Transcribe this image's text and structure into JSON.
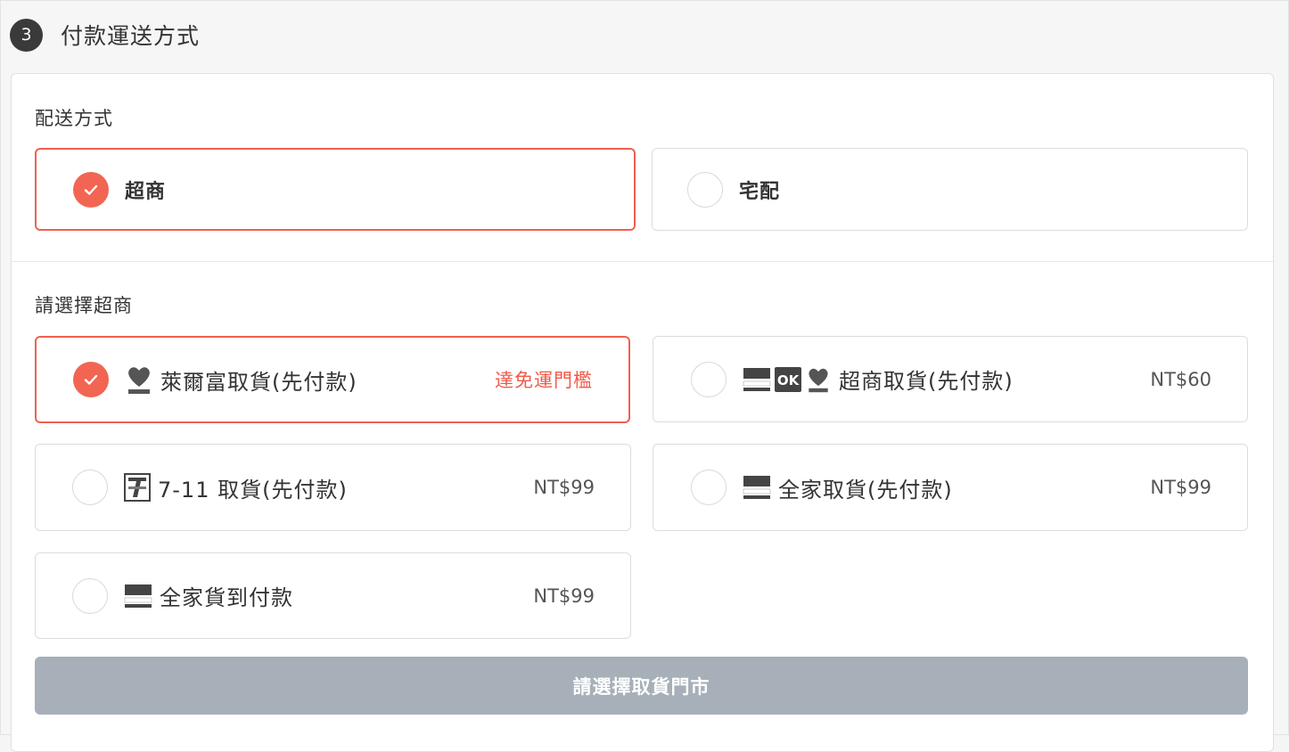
{
  "section": {
    "step": "3",
    "title": "付款運送方式"
  },
  "shipping": {
    "label": "配送方式",
    "options": [
      {
        "label": "超商",
        "selected": true
      },
      {
        "label": "宅配",
        "selected": false
      }
    ]
  },
  "store": {
    "label": "請選擇超商",
    "options": [
      {
        "label": "萊爾富取貨(先付款)",
        "note": "達免運門檻",
        "selected": true,
        "logos": [
          "hilife-logo"
        ]
      },
      {
        "label": "超商取貨(先付款)",
        "price": "NT$60",
        "selected": false,
        "logos": [
          "familymart-logo",
          "ok-mart-logo",
          "hilife-logo"
        ]
      },
      {
        "label": "7-11 取貨(先付款)",
        "price": "NT$99",
        "selected": false,
        "logos": [
          "seven-eleven-logo"
        ]
      },
      {
        "label": "全家取貨(先付款)",
        "price": "NT$99",
        "selected": false,
        "logos": [
          "familymart-logo"
        ]
      },
      {
        "label": "全家貨到付款",
        "price": "NT$99",
        "selected": false,
        "logos": [
          "familymart-logo"
        ]
      }
    ]
  },
  "cta": {
    "label": "請選擇取貨門市",
    "enabled": false
  },
  "colors": {
    "accent": "#f26553",
    "disabled_button": "#a7b0b8",
    "badge": "#3a3a3a"
  }
}
